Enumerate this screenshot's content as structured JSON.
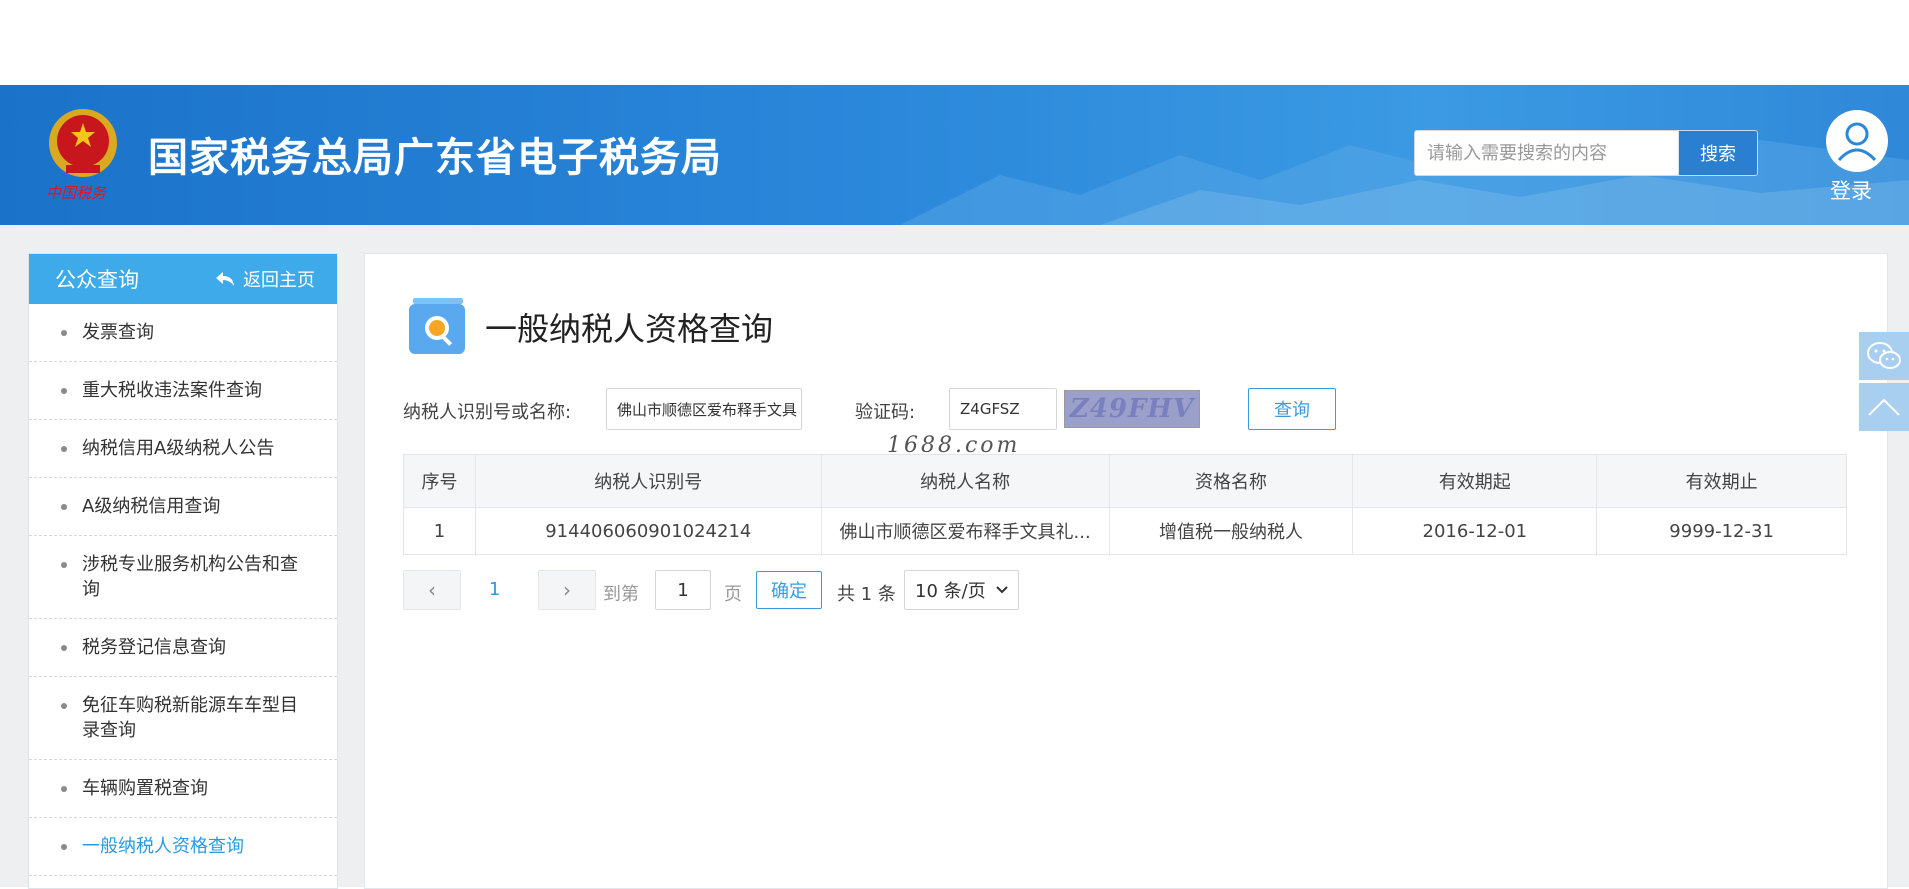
{
  "header": {
    "site_title": "国家税务总局广东省电子税务局",
    "search_placeholder": "请输入需要搜索的内容",
    "search_button": "搜索",
    "login_label": "登录",
    "emblem_text": "中国税务"
  },
  "sidebar": {
    "title": "公众查询",
    "back_home": "返回主页",
    "items": [
      {
        "label": "发票查询"
      },
      {
        "label": "重大税收违法案件查询"
      },
      {
        "label": "纳税信用A级纳税人公告"
      },
      {
        "label": "A级纳税信用查询"
      },
      {
        "label": "涉税专业服务机构公告和查询"
      },
      {
        "label": "税务登记信息查询"
      },
      {
        "label": "免征车购税新能源车车型目录查询"
      },
      {
        "label": "车辆购置税查询"
      },
      {
        "label": "一般纳税人资格查询",
        "active": true
      }
    ]
  },
  "main": {
    "heading": "一般纳税人资格查询",
    "form": {
      "taxpayer_label": "纳税人识别号或名称:",
      "taxpayer_value": "佛山市顺德区爱布释手文具",
      "captcha_label": "验证码:",
      "captcha_value": "Z4GFSZ",
      "captcha_image_text": "Z49FHV",
      "query_button": "查询"
    },
    "watermark": "1688.com",
    "table": {
      "headers": [
        "序号",
        "纳税人识别号",
        "纳税人名称",
        "资格名称",
        "有效期起",
        "有效期止"
      ],
      "rows": [
        [
          "1",
          "914406060901024214",
          "佛山市顺德区爱布释手文具礼...",
          "增值税一般纳税人",
          "2016-12-01",
          "9999-12-31"
        ]
      ]
    },
    "pagination": {
      "prev_icon": "‹",
      "next_icon": "›",
      "current_page": "1",
      "goto_label": "到第",
      "goto_value": "1",
      "page_suffix": "页",
      "confirm": "确定",
      "total": "共 1 条",
      "page_size": "10 条/页"
    }
  },
  "floating": {
    "wechat_icon": "wechat-icon",
    "back_to_top_icon": "chevron-up-icon"
  },
  "colors": {
    "header_blue": "#2a87da",
    "sidebar_header": "#3eaaea",
    "accent": "#2a9be0"
  }
}
